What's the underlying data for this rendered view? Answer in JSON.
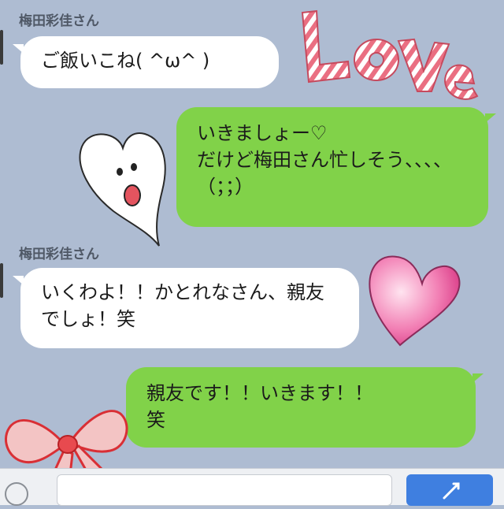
{
  "chat": {
    "messages": [
      {
        "direction": "incoming",
        "sender": "梅田彩佳さん",
        "text": "ご飯いこね( ^ω^ )"
      },
      {
        "direction": "outgoing",
        "text": "いきましょー♡\nだけど梅田さん忙しそう、、、、（；；）"
      },
      {
        "direction": "incoming",
        "sender": "梅田彩佳さん",
        "text": "いくわよ！！かとれなさん、親友でしょ！笑"
      },
      {
        "direction": "outgoing",
        "text": "親友です！！いきます！！\n笑"
      }
    ]
  },
  "decorations": {
    "love_sticker": "love-doodle",
    "ghost_heart": "surprised-heart-doodle",
    "pink_heart": "pink-heart-doodle",
    "red_bow": "red-ribbon-doodle"
  },
  "input_bar": {
    "placeholder": "",
    "emoji_icon": "smiley-icon",
    "send_icon": "send-icon"
  },
  "colors": {
    "background": "#aebcd2",
    "outgoing_bubble": "#81d249",
    "incoming_bubble": "#ffffff",
    "send_button": "#3f7fe0"
  }
}
